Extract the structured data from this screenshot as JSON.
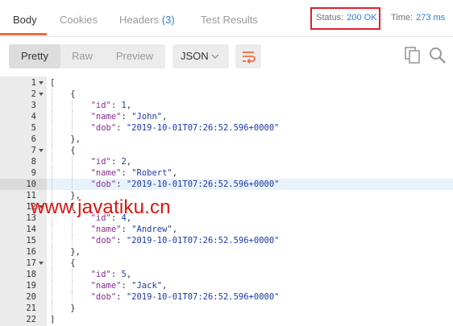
{
  "tabs": [
    {
      "label": "Body",
      "active": true
    },
    {
      "label": "Cookies",
      "active": false
    },
    {
      "label": "Headers",
      "count": "(3)",
      "active": false
    },
    {
      "label": "Test Results",
      "active": false
    }
  ],
  "status": {
    "label": "Status:",
    "value": "200 OK"
  },
  "time": {
    "label": "Time:",
    "value": "273 ms"
  },
  "toolbar": {
    "view_modes": [
      {
        "label": "Pretty",
        "active": true
      },
      {
        "label": "Raw",
        "active": false
      },
      {
        "label": "Preview",
        "active": false
      }
    ],
    "format": "JSON",
    "icons": [
      "wrap-lines-icon",
      "copy-icon",
      "search-icon"
    ]
  },
  "editor": {
    "highlighted_line": 10,
    "lines": [
      {
        "n": "1",
        "fold": true,
        "text": "["
      },
      {
        "n": "2",
        "fold": true,
        "text": "    {"
      },
      {
        "n": "3",
        "key": "\"id\"",
        "val": "1",
        "type": "num",
        "indent": 8,
        "comma": true
      },
      {
        "n": "4",
        "key": "\"name\"",
        "val": "\"John\"",
        "type": "str",
        "indent": 8,
        "comma": true
      },
      {
        "n": "5",
        "key": "\"dob\"",
        "val": "\"2019-10-01T07:26:52.596+0000\"",
        "type": "str",
        "indent": 8,
        "comma": false
      },
      {
        "n": "6",
        "text": "    },"
      },
      {
        "n": "7",
        "fold": true,
        "text": "    {"
      },
      {
        "n": "8",
        "key": "\"id\"",
        "val": "2",
        "type": "num",
        "indent": 8,
        "comma": true
      },
      {
        "n": "9",
        "key": "\"name\"",
        "val": "\"Robert\"",
        "type": "str",
        "indent": 8,
        "comma": true
      },
      {
        "n": "10",
        "key": "\"dob\"",
        "val": "\"2019-10-01T07:26:52.596+0000\"",
        "type": "str",
        "indent": 8,
        "comma": false
      },
      {
        "n": "11",
        "text": "    },"
      },
      {
        "n": "12",
        "fold": true,
        "text": "    {"
      },
      {
        "n": "13",
        "key": "\"id\"",
        "val": "4",
        "type": "num",
        "indent": 8,
        "comma": true
      },
      {
        "n": "14",
        "key": "\"name\"",
        "val": "\"Andrew\"",
        "type": "str",
        "indent": 8,
        "comma": true
      },
      {
        "n": "15",
        "key": "\"dob\"",
        "val": "\"2019-10-01T07:26:52.596+0000\"",
        "type": "str",
        "indent": 8,
        "comma": false
      },
      {
        "n": "16",
        "text": "    },"
      },
      {
        "n": "17",
        "fold": true,
        "text": "    {"
      },
      {
        "n": "18",
        "key": "\"id\"",
        "val": "5",
        "type": "num",
        "indent": 8,
        "comma": true
      },
      {
        "n": "19",
        "key": "\"name\"",
        "val": "\"Jack\"",
        "type": "str",
        "indent": 8,
        "comma": true
      },
      {
        "n": "20",
        "key": "\"dob\"",
        "val": "\"2019-10-01T07:26:52.596+0000\"",
        "type": "str",
        "indent": 8,
        "comma": false
      },
      {
        "n": "21",
        "text": "    }"
      },
      {
        "n": "22",
        "text": "]"
      }
    ]
  },
  "watermark": "www.javatiku.cn",
  "colors": {
    "accent": "#f26b3a",
    "link": "#2d7ed6",
    "status_box": "#e0202a",
    "json_key": "#8a2b8e",
    "json_value": "#1a3aa8",
    "watermark": "#e0140f"
  }
}
